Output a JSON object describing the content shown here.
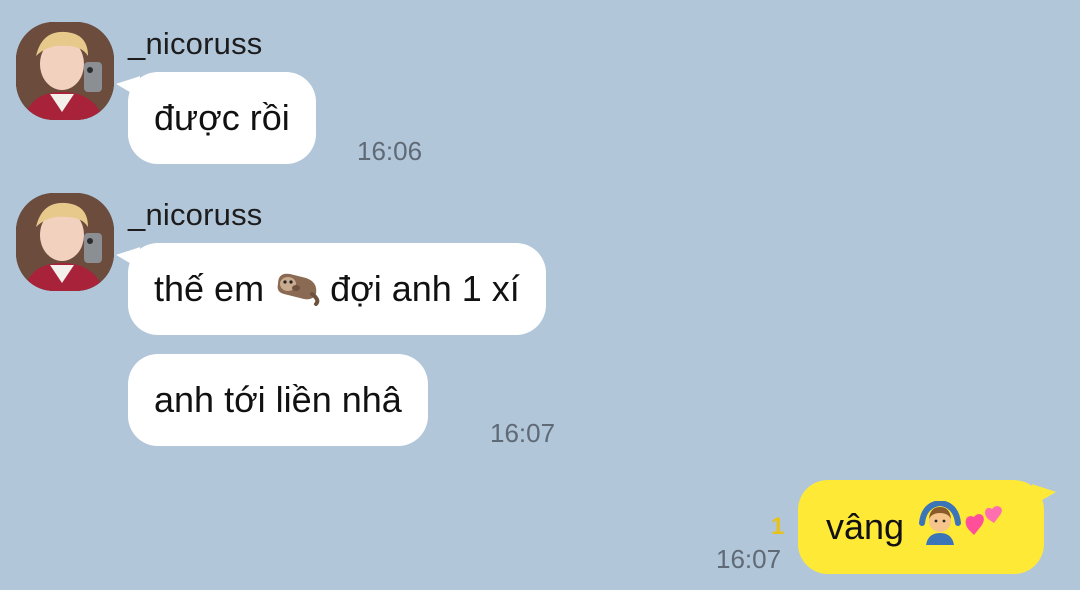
{
  "messages": [
    {
      "sender": "_nicoruss",
      "bubbles": [
        "được rồi"
      ],
      "time": "16:06"
    },
    {
      "sender": "_nicoruss",
      "bubbles": [
        {
          "before": "thế em",
          "emoji": "otter-emoji",
          "after": "đợi anh 1 xí"
        },
        "anh tới liền nhâ"
      ],
      "time": "16:07"
    }
  ],
  "my_message": {
    "text": "vâng",
    "emojis": [
      "person-gesturing-ok-emoji",
      "two-hearts-emoji"
    ],
    "unread_count": "1",
    "time": "16:07"
  },
  "colors": {
    "background": "#b2c6da",
    "incoming_bubble": "#ffffff",
    "outgoing_bubble": "#fde936",
    "unread": "#e6c21a"
  }
}
